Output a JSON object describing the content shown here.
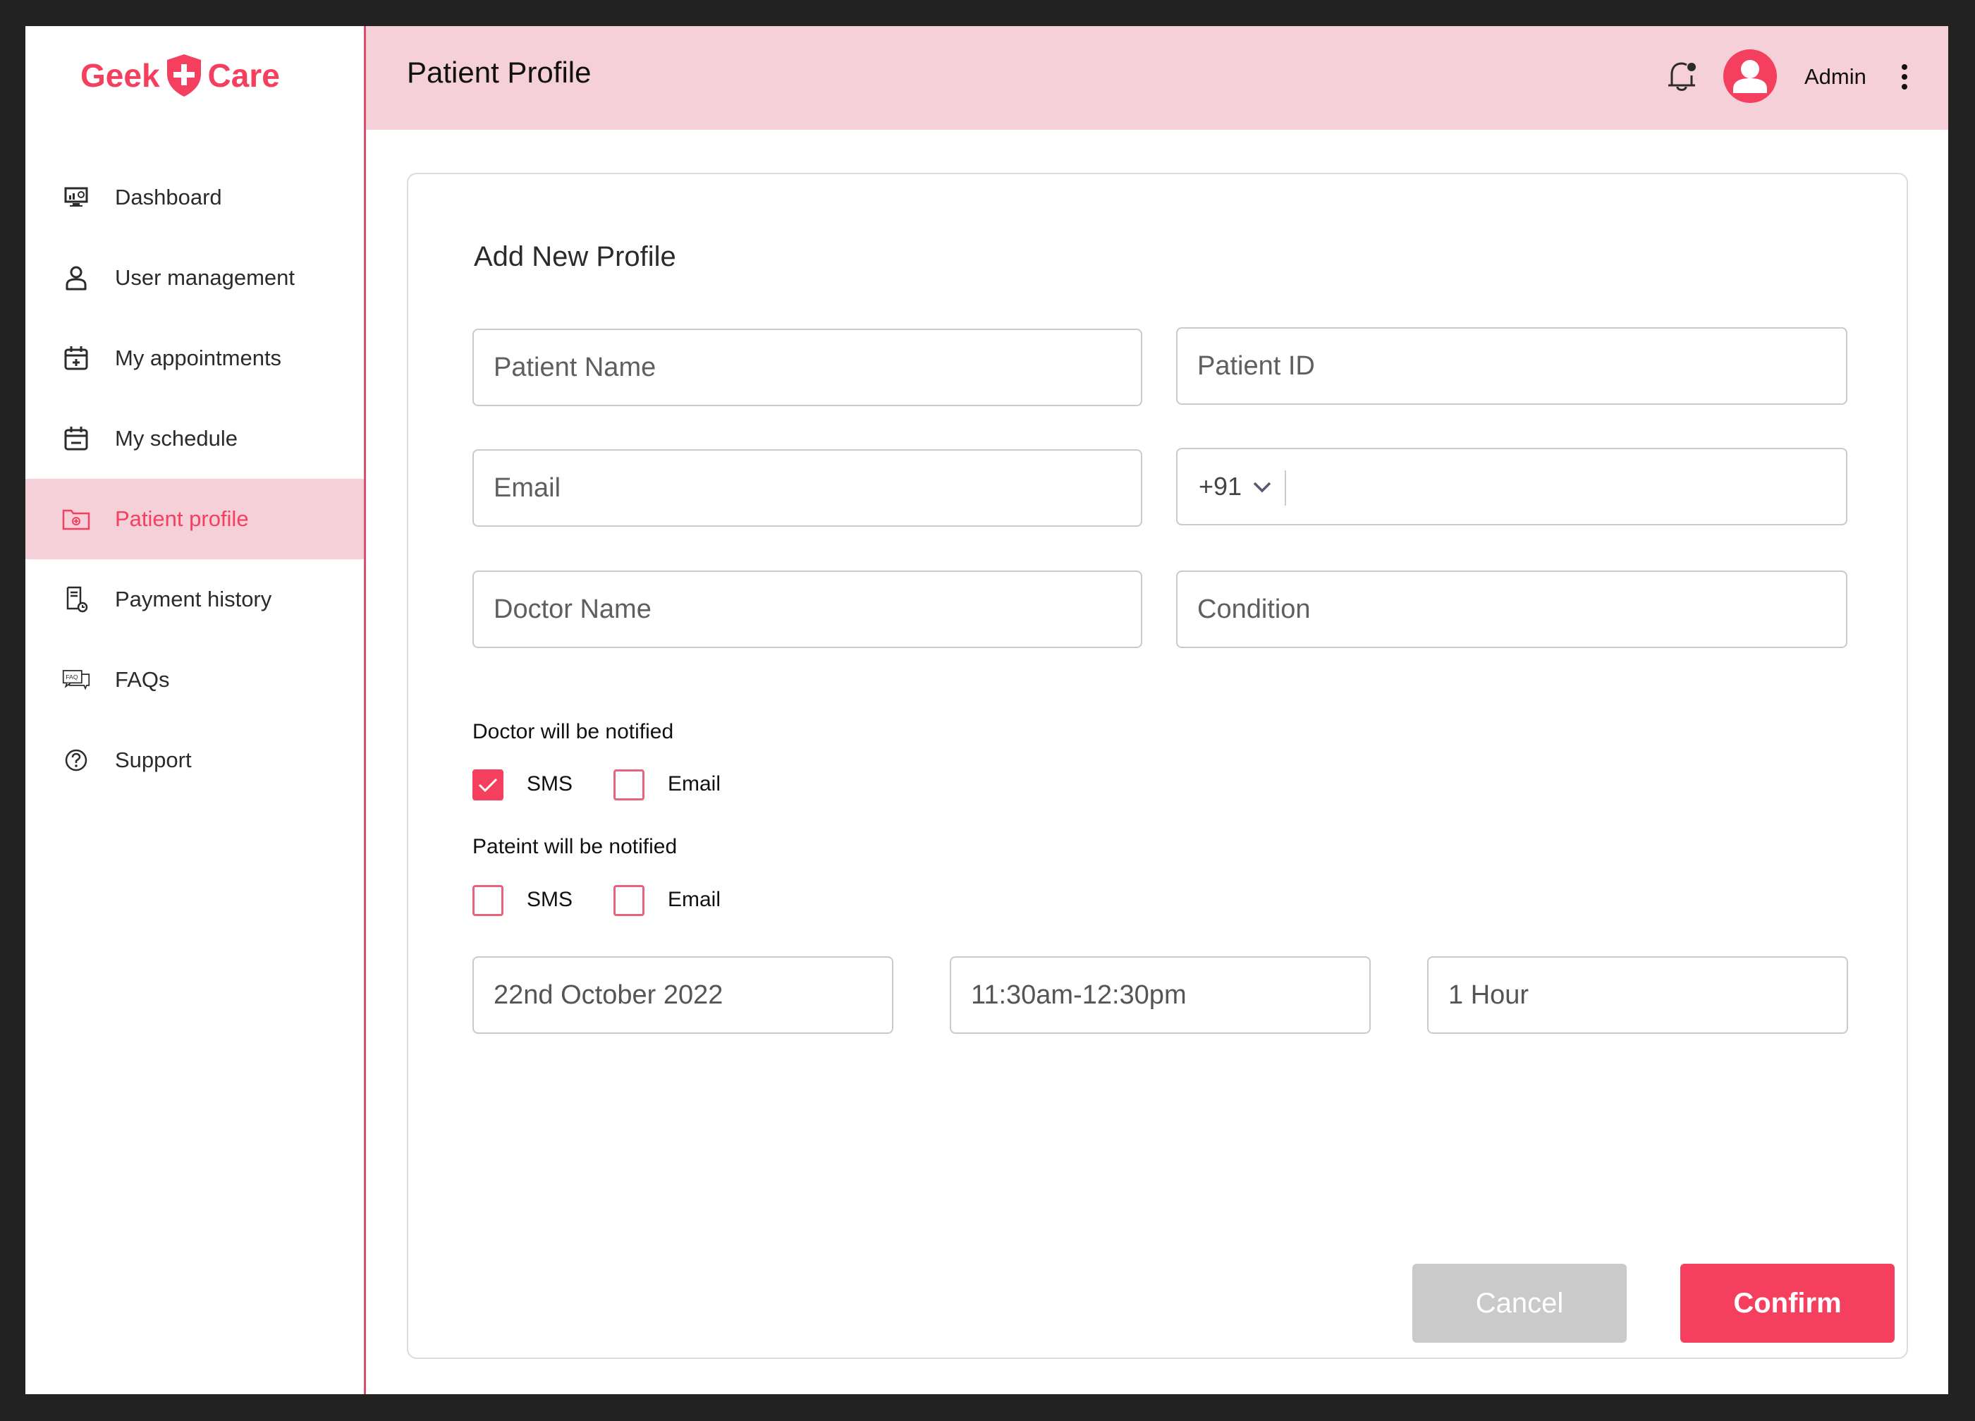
{
  "brand": {
    "name_left": "Geek",
    "name_right": "Care",
    "color": "#f43f5e"
  },
  "sidebar": {
    "items": [
      {
        "label": "Dashboard",
        "icon": "dashboard-monitor-icon",
        "active": false
      },
      {
        "label": "User management",
        "icon": "user-icon",
        "active": false
      },
      {
        "label": "My appointments",
        "icon": "calendar-plus-icon",
        "active": false
      },
      {
        "label": "My schedule",
        "icon": "calendar-icon",
        "active": false
      },
      {
        "label": "Patient profile",
        "icon": "medical-folder-icon",
        "active": true
      },
      {
        "label": "Payment history",
        "icon": "receipt-clock-icon",
        "active": false
      },
      {
        "label": "FAQs",
        "icon": "faq-chat-icon",
        "active": false
      },
      {
        "label": "Support",
        "icon": "question-circle-icon",
        "active": false
      }
    ]
  },
  "header": {
    "title": "Patient Profile",
    "user_name": "Admin",
    "icons": [
      "bell-notification-icon",
      "avatar-icon",
      "kebab-menu-icon"
    ]
  },
  "form": {
    "title": "Add New Profile",
    "fields": {
      "patient_name": {
        "placeholder": "Patient Name",
        "value": ""
      },
      "patient_id": {
        "placeholder": "Patient ID",
        "value": ""
      },
      "email": {
        "placeholder": "Email",
        "value": ""
      },
      "phone": {
        "country_code": "+91",
        "value": ""
      },
      "doctor_name": {
        "placeholder": "Doctor Name",
        "value": ""
      },
      "condition": {
        "placeholder": "Condition",
        "value": ""
      },
      "date": {
        "value": "22nd October 2022"
      },
      "time": {
        "value": "11:30am-12:30pm"
      },
      "duration": {
        "value": "1 Hour"
      }
    },
    "doctor_notify": {
      "label": "Doctor will be notified",
      "options": [
        {
          "label": "SMS",
          "checked": true
        },
        {
          "label": "Email",
          "checked": false
        }
      ]
    },
    "patient_notify": {
      "label": "Pateint will be notified",
      "options": [
        {
          "label": "SMS",
          "checked": false
        },
        {
          "label": "Email",
          "checked": false
        }
      ]
    },
    "buttons": {
      "cancel": "Cancel",
      "confirm": "Confirm"
    }
  },
  "colors": {
    "accent": "#f43f5e",
    "active_bg": "#f5d0d8",
    "disabled": "#cacaca"
  }
}
